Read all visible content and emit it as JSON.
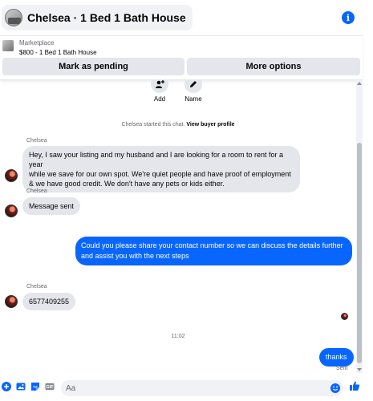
{
  "header": {
    "title": "Chelsea · 1 Bed 1 Bath House",
    "info_icon": "info-icon"
  },
  "marketplace": {
    "label": "Marketplace",
    "listing": "$800 - 1 Bed 1 Bath House",
    "pending_button": "Mark as pending",
    "more_button": "More options"
  },
  "actions": [
    {
      "label": "Add",
      "icon": "add-person-icon"
    },
    {
      "label": "Name",
      "icon": "pencil-icon"
    }
  ],
  "system": {
    "started": "Chelsea started this chat.",
    "link": "View buyer profile"
  },
  "messages": [
    {
      "sender": "Chelsea",
      "text_lines": [
        "Hey, I saw your listing and my husband and I are looking for a room to rent for a year",
        "while we save for our own spot. We're quiet people and have proof of employment",
        "& we have good credit. We don't have any pets or kids either."
      ]
    },
    {
      "sender": "Chelsea",
      "text": "Message sent"
    },
    {
      "text_lines": [
        "Could you please share your contact number so we can discuss the details further",
        "and assist you with the next steps"
      ]
    },
    {
      "sender": "Chelsea",
      "text": "6577409255"
    },
    {
      "text": "thanks",
      "status": "Sent"
    }
  ],
  "timestamp": "11:02",
  "composer": {
    "placeholder": "Aa",
    "value": ""
  },
  "colors": {
    "accent": "#0866ff",
    "bubble_in": "#e4e6eb",
    "pill": "#f0f2f5",
    "muted_text": "#65676b"
  }
}
